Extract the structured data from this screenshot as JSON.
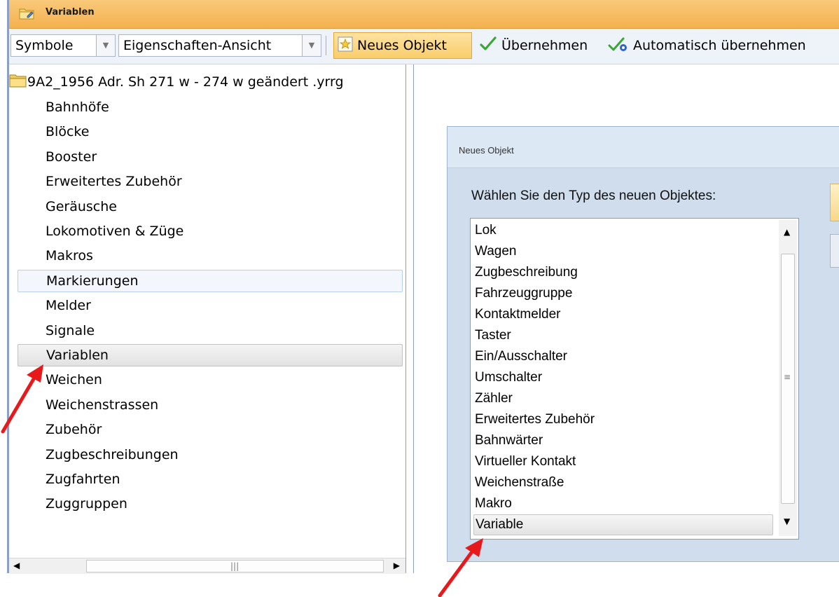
{
  "window": {
    "title": "Variablen"
  },
  "toolbar": {
    "view_mode": "Symbole",
    "view_style": "Eigenschaften-Ansicht",
    "new_object_label": "Neues Objekt",
    "apply_label": "Übernehmen",
    "auto_apply_label": "Automatisch übernehmen"
  },
  "tree": {
    "root_label": "9A2_1956   Adr. Sh 271 w - 274 w   geändert  .yrrg",
    "items": [
      {
        "label": "Bahnhöfe",
        "state": "normal"
      },
      {
        "label": "Blöcke",
        "state": "normal"
      },
      {
        "label": "Booster",
        "state": "normal"
      },
      {
        "label": "Erweitertes Zubehör",
        "state": "normal"
      },
      {
        "label": "Geräusche",
        "state": "normal"
      },
      {
        "label": "Lokomotiven & Züge",
        "state": "normal"
      },
      {
        "label": "Makros",
        "state": "normal"
      },
      {
        "label": "Markierungen",
        "state": "hover"
      },
      {
        "label": "Melder",
        "state": "normal"
      },
      {
        "label": "Signale",
        "state": "normal"
      },
      {
        "label": "Variablen",
        "state": "selected"
      },
      {
        "label": "Weichen",
        "state": "normal"
      },
      {
        "label": "Weichenstrassen",
        "state": "normal"
      },
      {
        "label": "Zubehör",
        "state": "normal"
      },
      {
        "label": "Zugbeschreibungen",
        "state": "normal"
      },
      {
        "label": "Zugfahrten",
        "state": "normal"
      },
      {
        "label": "Zuggruppen",
        "state": "normal"
      }
    ]
  },
  "dialog": {
    "title": "Neues Objekt",
    "prompt": "Wählen Sie den Typ des neuen Objektes:",
    "types": [
      "Lok",
      "Wagen",
      "Zugbeschreibung",
      "Fahrzeuggruppe",
      "Kontaktmelder",
      "Taster",
      "Ein/Ausschalter",
      "Umschalter",
      "Zähler",
      "Erweitertes Zubehör",
      "Bahnwärter",
      "Virtueller Kontakt",
      "Weichenstraße",
      "Makro",
      "Variable"
    ],
    "selected_type": "Variable"
  },
  "colors": {
    "title_bar": "#f4b14f",
    "toolbar_active": "#f9cd6a",
    "dialog_bg": "#cfdded",
    "annotation_arrow": "#e8191b"
  },
  "icons": {
    "title": "folder-edit-icon",
    "new_object": "star-new-icon",
    "apply": "checkmark-icon",
    "auto_apply": "auto-apply-icon",
    "tree_root": "folder-icon"
  }
}
